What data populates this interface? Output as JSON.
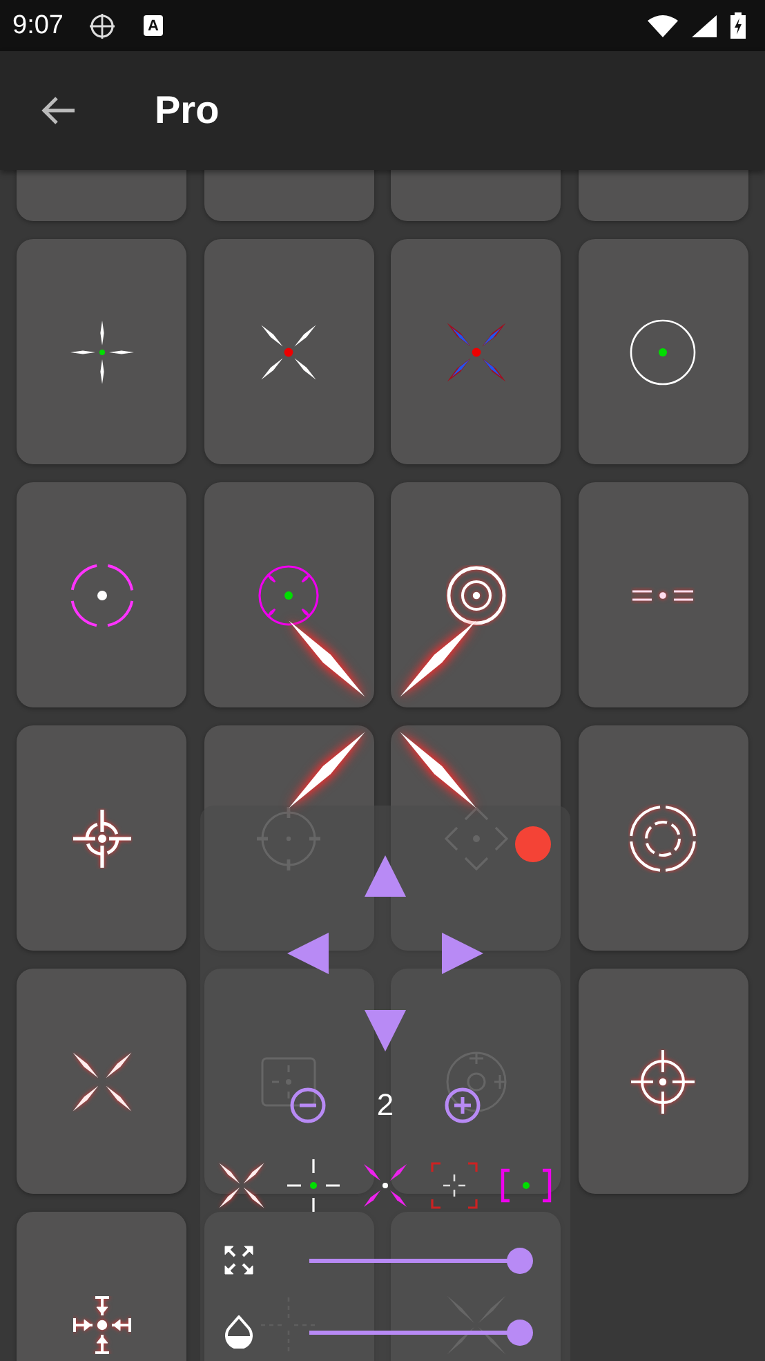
{
  "status_bar": {
    "time": "9:07",
    "keyboard_badge": "A"
  },
  "app_bar": {
    "title": "Pro"
  },
  "control_panel": {
    "zoom_value": "2",
    "sliders": [
      {
        "kind": "size",
        "level": 1
      },
      {
        "kind": "opacity",
        "level": 1
      }
    ]
  }
}
